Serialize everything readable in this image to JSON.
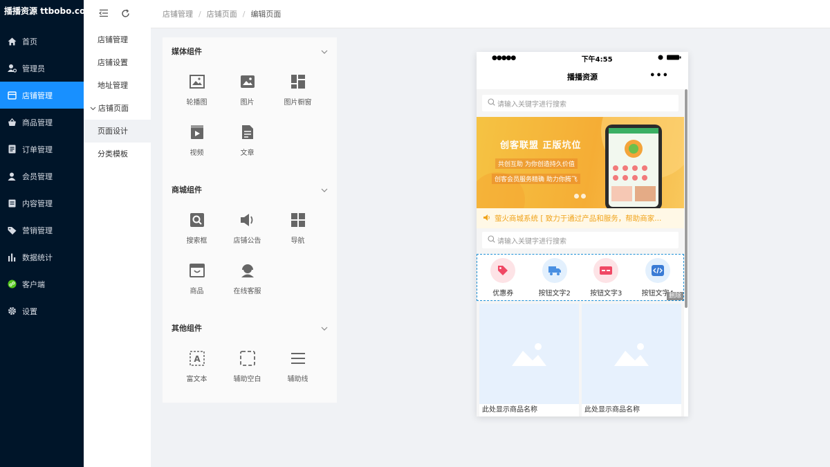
{
  "brand": {
    "logo_text": "播播资源 ttbobo.com"
  },
  "sidebar": {
    "items": [
      {
        "label": "首页",
        "icon": "home-icon"
      },
      {
        "label": "管理员",
        "icon": "admin-user-icon"
      },
      {
        "label": "店铺管理",
        "icon": "store-icon",
        "active": true
      },
      {
        "label": "商品管理",
        "icon": "basket-icon"
      },
      {
        "label": "订单管理",
        "icon": "order-icon"
      },
      {
        "label": "会员管理",
        "icon": "member-icon"
      },
      {
        "label": "内容管理",
        "icon": "content-icon"
      },
      {
        "label": "营销管理",
        "icon": "tag-icon"
      },
      {
        "label": "数据统计",
        "icon": "chart-icon"
      },
      {
        "label": "客户端",
        "icon": "client-icon"
      },
      {
        "label": "设置",
        "icon": "gear-icon"
      }
    ]
  },
  "subnav": {
    "items": [
      {
        "label": "店铺管理"
      },
      {
        "label": "店铺设置"
      },
      {
        "label": "地址管理"
      },
      {
        "label": "店铺页面",
        "group": true
      },
      {
        "label": "页面设计",
        "active": true
      },
      {
        "label": "分类模板"
      }
    ]
  },
  "breadcrumb": [
    "店铺管理",
    "店铺页面",
    "编辑页面"
  ],
  "panel": {
    "sections": [
      {
        "title": "媒体组件",
        "items": [
          {
            "label": "轮播图",
            "icon": "carousel-icon"
          },
          {
            "label": "图片",
            "icon": "image-icon"
          },
          {
            "label": "图片橱窗",
            "icon": "image-window-icon"
          },
          {
            "label": "视频",
            "icon": "video-icon"
          },
          {
            "label": "文章",
            "icon": "article-icon"
          }
        ]
      },
      {
        "title": "商城组件",
        "items": [
          {
            "label": "搜索框",
            "icon": "search-box-icon"
          },
          {
            "label": "店铺公告",
            "icon": "announcement-icon"
          },
          {
            "label": "导航",
            "icon": "navigation-icon"
          },
          {
            "label": "商品",
            "icon": "goods-icon"
          },
          {
            "label": "在线客服",
            "icon": "customer-service-icon"
          }
        ]
      },
      {
        "title": "其他组件",
        "items": [
          {
            "label": "富文本",
            "icon": "rich-text-icon"
          },
          {
            "label": "辅助空白",
            "icon": "blank-space-icon"
          },
          {
            "label": "辅助线",
            "icon": "divider-line-icon"
          }
        ]
      }
    ]
  },
  "phone": {
    "time": "下午4:55",
    "title": "播播资源",
    "more": "•••",
    "search_placeholder": "请输入关键字进行搜索",
    "banner": {
      "headline": "创客联盟 正版坑位",
      "line2": "共创互助 为你创造持久价值",
      "line3": "创客会员服务精确 助力你腾飞"
    },
    "notice": "萤火商城系统 [ 致力于通过产品和服务，帮助商家...",
    "search_placeholder_2": "请输入关键字进行搜索",
    "nav_buttons": [
      {
        "label": "优惠券",
        "color": "#fde3e6",
        "icon": "coupon-icon"
      },
      {
        "label": "按钮文字2",
        "color": "#e3f0fd",
        "icon": "truck-icon"
      },
      {
        "label": "按钮文字3",
        "color": "#fde3e6",
        "icon": "card-icon"
      },
      {
        "label": "按钮文字4",
        "color": "#e3f0fd",
        "icon": "code-icon"
      }
    ],
    "delete_label": "删除",
    "goods": [
      {
        "name": "此处显示商品名称"
      },
      {
        "name": "此处显示商品名称"
      }
    ]
  },
  "colors": {
    "sidebar_bg": "#001529",
    "active_blue": "#1890ff",
    "notice_text": "#f0a31b"
  }
}
